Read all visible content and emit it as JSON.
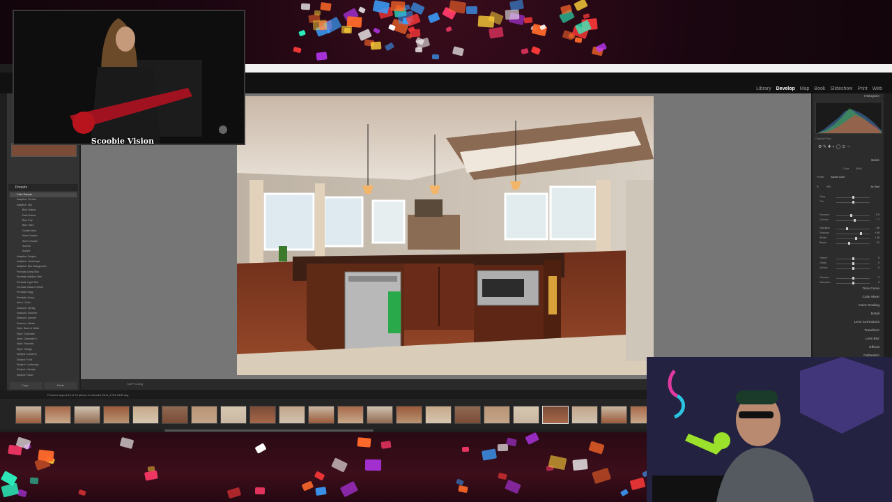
{
  "modules": [
    "Library",
    "Develop",
    "Map",
    "Book",
    "Slideshow",
    "Print",
    "Web"
  ],
  "active_module": "Develop",
  "presets": {
    "header": "Presets",
    "items": [
      {
        "label": "Color Presets",
        "level": 0,
        "selected": true
      },
      {
        "label": "Adaptive: Portrait",
        "level": 0
      },
      {
        "label": "Adaptive: Sky",
        "level": 0
      },
      {
        "label": "Blue Drama",
        "level": 1
      },
      {
        "label": "Dark Drama",
        "level": 1
      },
      {
        "label": "Blue Pop",
        "level": 1
      },
      {
        "label": "Blue Haze",
        "level": 1
      },
      {
        "label": "Golden Hour",
        "level": 1
      },
      {
        "label": "Moon Tropics",
        "level": 1
      },
      {
        "label": "Storm Clouds",
        "level": 1
      },
      {
        "label": "Sunrise",
        "level": 1
      },
      {
        "label": "Sunset",
        "level": 1
      },
      {
        "label": "Adaptive: Subject",
        "level": 0
      },
      {
        "label": "Adaptive: Landscape",
        "level": 0
      },
      {
        "label": "Adaptive: Blur Background",
        "level": 0
      },
      {
        "label": "Portraits: Deep Skin",
        "level": 0
      },
      {
        "label": "Portraits: Medium Skin",
        "level": 0
      },
      {
        "label": "Portraits: Light Skin",
        "level": 0
      },
      {
        "label": "Portraits: Black & White",
        "level": 0
      },
      {
        "label": "Portraits: Edgy",
        "level": 0
      },
      {
        "label": "Portraits: Group",
        "level": 0
      },
      {
        "label": "Auto+: Color",
        "level": 0
      },
      {
        "label": "Seasons: Spring",
        "level": 0
      },
      {
        "label": "Seasons: Summer",
        "level": 0
      },
      {
        "label": "Seasons: Autumn",
        "level": 0
      },
      {
        "label": "Seasons: Winter",
        "level": 0
      },
      {
        "label": "Style: Black & White",
        "level": 0
      },
      {
        "label": "Style: Cinematic",
        "level": 0
      },
      {
        "label": "Style: Cinematic II",
        "level": 0
      },
      {
        "label": "Style: Futuristic",
        "level": 0
      },
      {
        "label": "Style: Vintage",
        "level": 0
      },
      {
        "label": "Subject: Concerts",
        "level": 0
      },
      {
        "label": "Subject: Food",
        "level": 0
      },
      {
        "label": "Subject: Landscape",
        "level": 0
      },
      {
        "label": "Subject: Lifestyle",
        "level": 0
      },
      {
        "label": "Subject: Travel",
        "level": 0
      }
    ]
  },
  "left_buttons": [
    "Copy...",
    "Paste"
  ],
  "toolbar": {
    "label": "Soft Proofing"
  },
  "right_panel": {
    "header_histogram": "Histogram",
    "original_photo": "Original Photo",
    "basic": "Basic",
    "profile_label": "Profile:",
    "profile_value": "Adobe Color",
    "wb_label": "WB:",
    "wb_value": "As Shot",
    "treatment": [
      "Color",
      "B&W"
    ],
    "sliders": [
      {
        "name": "Temp",
        "val": "",
        "pos": 0.5
      },
      {
        "name": "Tint",
        "val": "",
        "pos": 0.5
      },
      {
        "name": "Exposure",
        "val": "- 0.9",
        "pos": 0.45
      },
      {
        "name": "Contrast",
        "val": "+ 7",
        "pos": 0.56
      },
      {
        "name": "Highlights",
        "val": "- 35",
        "pos": 0.32
      },
      {
        "name": "Shadows",
        "val": "+ 48",
        "pos": 0.74
      },
      {
        "name": "Whites",
        "val": "+ 16",
        "pos": 0.6
      },
      {
        "name": "Blacks",
        "val": "- 22",
        "pos": 0.38
      },
      {
        "name": "Texture",
        "val": "0",
        "pos": 0.5
      },
      {
        "name": "Clarity",
        "val": "0",
        "pos": 0.5
      },
      {
        "name": "Dehaze",
        "val": "0",
        "pos": 0.5
      },
      {
        "name": "Vibrance",
        "val": "0",
        "pos": 0.5
      },
      {
        "name": "Saturation",
        "val": "0",
        "pos": 0.5
      }
    ],
    "sections": [
      "Tone Curve",
      "Color Mixer",
      "Color Grading",
      "Detail",
      "Lens Corrections",
      "Transform",
      "Lens Blur",
      "Effects",
      "Calibration"
    ]
  },
  "filmstrip": {
    "info": "Previous Import    63 of 78 photos /1 selected /DLN_1754-HDR.dng",
    "count": 22,
    "selected_index": 18
  },
  "overlays": {
    "top_cam_label": "Scoobie Vision"
  }
}
